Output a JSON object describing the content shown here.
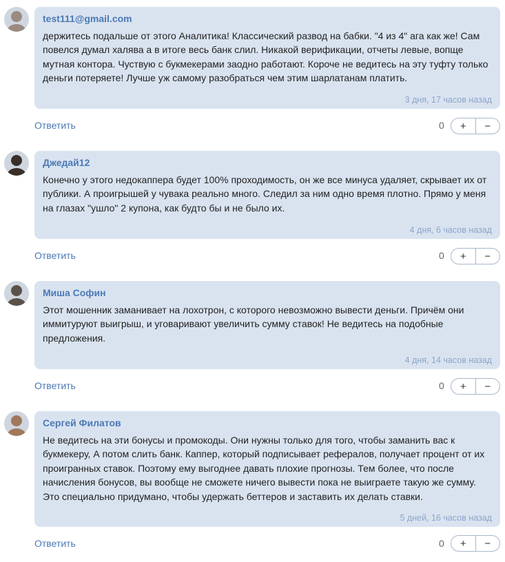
{
  "comments": [
    {
      "author": "test111@gmail.com",
      "lines": [
        "держитесь подальше от этого Аналитика! Классический развод на бабки. \"4 из 4\" ага как же! Сам",
        "повелся думал халява а в итоге весь банк слил. Никакой верификации, отчеты левые, вопще",
        "мутная контора. Чуствую с букмекерами заодно работают. Короче не ведитесь на эту туфту только",
        "деньги потеряете! Лучше уж самому разобраться чем этим шарлатанам платить."
      ],
      "time": "3 дня, 17 часов назад",
      "reply": "Ответить",
      "score": "0",
      "plus": "+",
      "minus": "−",
      "avatar_color": "#9a8a80"
    },
    {
      "author": "Джедай12",
      "lines": [
        "Конечно у этого недокаппера будет 100% проходимость, он же все минуса удаляет, скрывает их от",
        "публики. А проигрышей у чувака реально много. Следил за ним одно время плотно. Прямо у меня",
        "на глазах \"ушло\" 2 купона, как будто бы и не было их."
      ],
      "time": "4 дня, 6 часов назад",
      "reply": "Ответить",
      "score": "0",
      "plus": "+",
      "minus": "−",
      "avatar_color": "#3a2f28"
    },
    {
      "author": "Миша Софин",
      "lines": [
        "Этот мошенник заманивает на лохотрон, с которого невозможно вывести деньги. Причём они",
        "иммитуруют выигрыш, и уговаривают увеличить сумму ставок! Не ведитесь на подобные",
        "предложения."
      ],
      "time": "4 дня, 14 часов назад",
      "reply": "Ответить",
      "score": "0",
      "plus": "+",
      "minus": "−",
      "avatar_color": "#5a5148"
    },
    {
      "author": "Сергей Филатов",
      "lines": [
        "Не ведитесь на эти бонусы и промокоды. Они нужны только для того, чтобы заманить вас к",
        "букмекеру, А потом слить банк. Каппер, который подписывает рефералов, получает процент от их",
        "проигранных ставок. Поэтому ему выгоднее давать плохие прогнозы. Тем более, что после",
        "начисления бонусов, вы вообще не сможете ничего вывести пока не выиграете такую же сумму.",
        "Это специально придумано, чтобы удержать беттеров и заставить их делать ставки."
      ],
      "time": "5 дней, 16 часов назад",
      "reply": "Ответить",
      "score": "0",
      "plus": "+",
      "minus": "−",
      "avatar_color": "#a0785a"
    }
  ]
}
